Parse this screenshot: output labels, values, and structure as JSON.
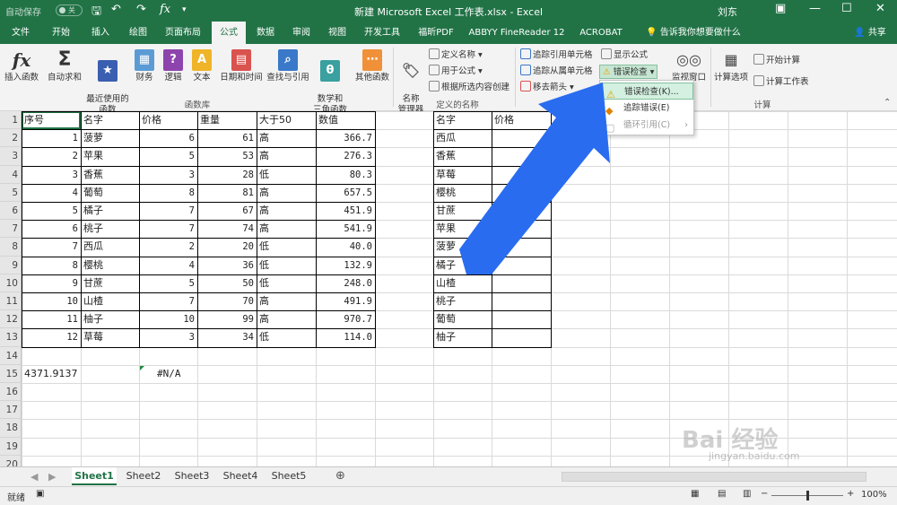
{
  "titlebar": {
    "autosave_label": "自动保存",
    "autosave_state": "关",
    "title": "新建 Microsoft Excel 工作表.xlsx  -  Excel",
    "user": "刘东"
  },
  "ribbon_tabs": [
    "文件",
    "开始",
    "插入",
    "绘图",
    "页面布局",
    "公式",
    "数据",
    "审阅",
    "视图",
    "开发工具",
    "福昕PDF",
    "ABBYY FineReader 12",
    "ACROBAT"
  ],
  "active_tab": "公式",
  "tell_me": "告诉我你想要做什么",
  "share": "共享",
  "library": {
    "insert_function": "插入函数",
    "autosum": "自动求和",
    "recent": "最近使用的\n函数",
    "financial": "财务",
    "logical": "逻辑",
    "text": "文本",
    "datetime": "日期和时间",
    "lookup": "查找与引用",
    "math": "数学和\n三角函数",
    "more": "其他函数",
    "group_label": "函数库"
  },
  "names": {
    "name_manager": "名称\n管理器",
    "define_name": "定义名称",
    "use_in_formula": "用于公式",
    "create_from_selection": "根据所选内容创建",
    "group_label": "定义的名称"
  },
  "auditing": {
    "trace_precedents": "追踪引用单元格",
    "trace_dependents": "追踪从属单元格",
    "remove_arrows": "移去箭头",
    "show_formulas": "显示公式",
    "error_checking": "错误检查",
    "watch_window": "监视窗口"
  },
  "calculation": {
    "calc_options": "计算选项",
    "calc_now": "开始计算",
    "calc_sheet": "计算工作表",
    "group_label": "计算"
  },
  "error_menu": {
    "items": [
      "错误检查(K)...",
      "追踪错误(E)",
      "循环引用(C)"
    ]
  },
  "table1": {
    "headers": [
      "序号",
      "名字",
      "价格",
      "重量",
      "大于50",
      "数值"
    ],
    "rows": [
      [
        "1",
        "菠萝",
        "6",
        "61",
        "高",
        "366.7"
      ],
      [
        "2",
        "苹果",
        "5",
        "53",
        "高",
        "276.3"
      ],
      [
        "3",
        "香蕉",
        "3",
        "28",
        "低",
        "80.3"
      ],
      [
        "4",
        "葡萄",
        "8",
        "81",
        "高",
        "657.5"
      ],
      [
        "5",
        "橘子",
        "7",
        "67",
        "高",
        "451.9"
      ],
      [
        "6",
        "桃子",
        "7",
        "74",
        "高",
        "541.9"
      ],
      [
        "7",
        "西瓜",
        "2",
        "20",
        "低",
        "40.0"
      ],
      [
        "8",
        "樱桃",
        "4",
        "36",
        "低",
        "132.9"
      ],
      [
        "9",
        "甘蔗",
        "5",
        "50",
        "低",
        "248.0"
      ],
      [
        "10",
        "山楂",
        "7",
        "70",
        "高",
        "491.9"
      ],
      [
        "11",
        "柚子",
        "10",
        "99",
        "高",
        "970.7"
      ],
      [
        "12",
        "草莓",
        "3",
        "34",
        "低",
        "114.0"
      ]
    ]
  },
  "table2": {
    "headers": [
      "名字",
      "价格"
    ],
    "names": [
      "西瓜",
      "香蕉",
      "草莓",
      "樱桃",
      "甘蔗",
      "苹果",
      "菠萝",
      "橘子",
      "山楂",
      "桃子",
      "葡萄",
      "柚子"
    ]
  },
  "row15": {
    "a": "4371.9137",
    "c": "#N/A"
  },
  "row_numbers": [
    "1",
    "2",
    "3",
    "4",
    "5",
    "6",
    "7",
    "8",
    "9",
    "10",
    "11",
    "12",
    "13",
    "14",
    "15",
    "16",
    "17",
    "18",
    "19",
    "20"
  ],
  "sheets": [
    "Sheet1",
    "Sheet2",
    "Sheet3",
    "Sheet4",
    "Sheet5"
  ],
  "active_sheet": "Sheet1",
  "status": {
    "ready": "就绪",
    "zoom": "100%"
  },
  "watermark": {
    "brand": "Bai 经验",
    "url": "jingyan.baidu.com"
  },
  "colors": {
    "accent": "#217346",
    "arrow": "#2a6cf0"
  }
}
